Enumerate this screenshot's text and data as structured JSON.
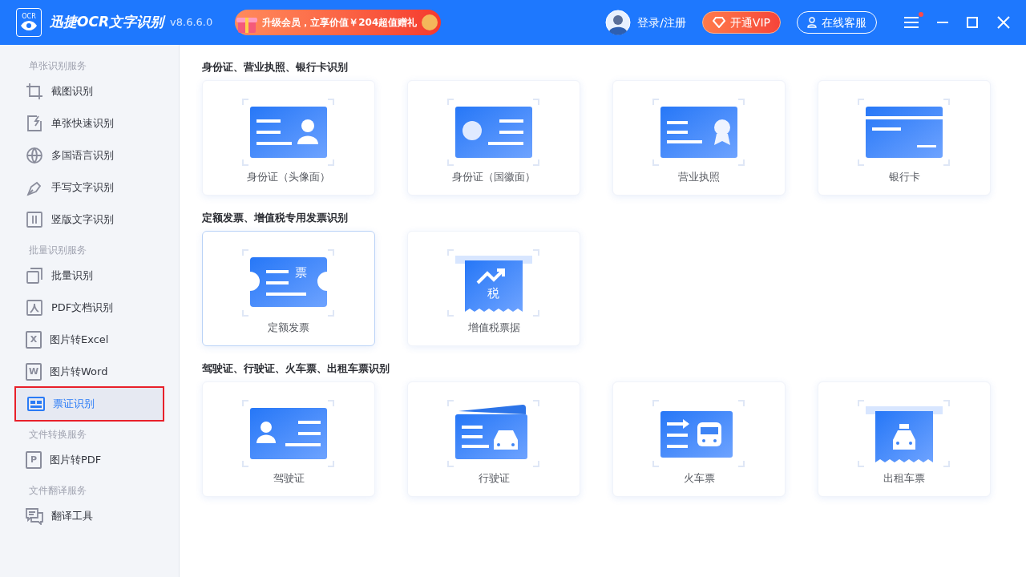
{
  "header": {
    "logo_text": "OCR",
    "title": "迅捷OCR文字识别",
    "version": "v8.6.6.0",
    "promo": "升级会员，立享价值￥204超值赠礼",
    "login": "登录/注册",
    "vip": "开通VIP",
    "service": "在线客服",
    "menu_badge": true
  },
  "sidebar": [
    {
      "heading": "单张识别服务",
      "items": [
        {
          "label": "截图识别",
          "kind": "crop",
          "selected": false
        },
        {
          "label": "单张快速识别",
          "kind": "quick",
          "selected": false
        },
        {
          "label": "多国语言识别",
          "kind": "globe",
          "selected": false
        },
        {
          "label": "手写文字识别",
          "kind": "pen",
          "selected": false
        },
        {
          "label": "竖版文字识别",
          "kind": "vertical",
          "selected": false
        }
      ]
    },
    {
      "heading": "批量识别服务",
      "items": [
        {
          "label": "批量识别",
          "kind": "batch",
          "selected": false
        },
        {
          "label": "PDF文档识别",
          "kind": "pdf",
          "selected": false
        },
        {
          "label": "图片转Excel",
          "kind": "letter",
          "letter": "X",
          "selected": false
        },
        {
          "label": "图片转Word",
          "kind": "letter",
          "letter": "W",
          "selected": false
        },
        {
          "label": "票证识别",
          "kind": "ticket",
          "selected": true
        }
      ]
    },
    {
      "heading": "文件转换服务",
      "items": [
        {
          "label": "图片转PDF",
          "kind": "letter",
          "letter": "P",
          "selected": false
        }
      ]
    },
    {
      "heading": "文件翻译服务",
      "items": [
        {
          "label": "翻译工具",
          "kind": "translate",
          "selected": false
        }
      ]
    }
  ],
  "sections": [
    {
      "title": "身份证、营业执照、银行卡识别",
      "cards": [
        {
          "label": "身份证（头像面）",
          "kind": "portrait",
          "highlighted": false
        },
        {
          "label": "身份证（国徽面）",
          "kind": "emblem",
          "highlighted": false
        },
        {
          "label": "营业执照",
          "kind": "license",
          "highlighted": false
        },
        {
          "label": "银行卡",
          "kind": "bankcard",
          "highlighted": false
        }
      ]
    },
    {
      "title": "定额发票、增值税专用发票识别",
      "cards": [
        {
          "label": "定额发票",
          "kind": "ticket",
          "icon_text": "票",
          "highlighted": true
        },
        {
          "label": "增值税票据",
          "kind": "tax",
          "icon_text": "税",
          "highlighted": false
        }
      ]
    },
    {
      "title": "驾驶证、行驶证、火车票、出租车票识别",
      "cards": [
        {
          "label": "驾驶证",
          "kind": "driver",
          "highlighted": false
        },
        {
          "label": "行驶证",
          "kind": "vehicle",
          "highlighted": false
        },
        {
          "label": "火车票",
          "kind": "train",
          "highlighted": false
        },
        {
          "label": "出租车票",
          "kind": "taxi",
          "highlighted": false
        }
      ]
    }
  ]
}
